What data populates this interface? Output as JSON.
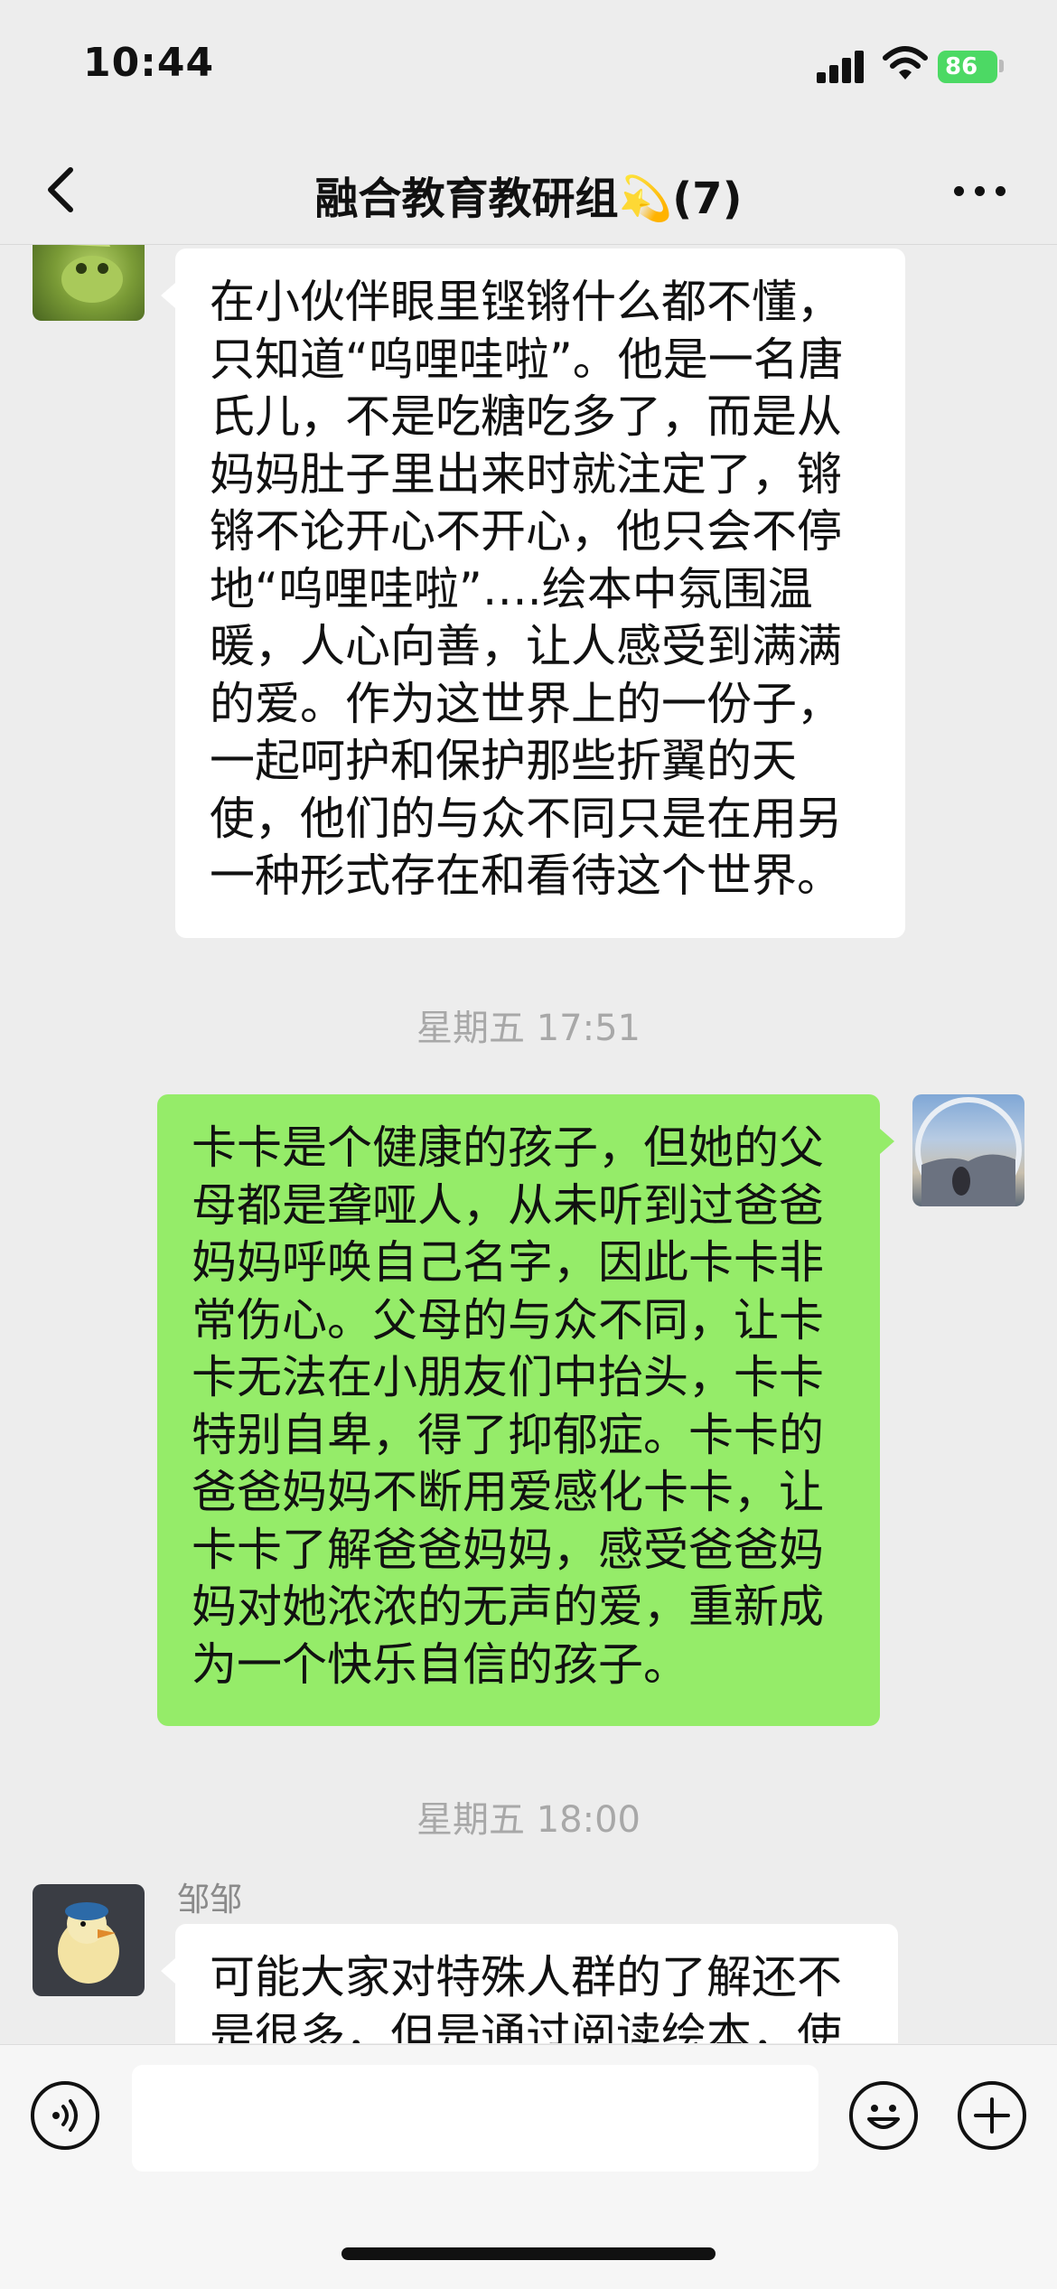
{
  "status_bar": {
    "time": "10:44",
    "battery": "86"
  },
  "nav": {
    "title": "融合教育教研组💫(7)"
  },
  "messages": [
    {
      "type": "left",
      "text": "在小伙伴眼里铿锵什么都不懂，只知道“呜哩哇啦”。他是一名唐氏儿，不是吃糖吃多了，而是从妈妈肚子里出来时就注定了，锵锵不论开心不开心，他只会不停地“呜哩哇啦”….绘本中氛围温暖，人心向善，让人感受到满满的爱。作为这世界上的一份子，一起呵护和保护那些折翼的天使，他们的与众不同只是在用另一种形式存在和看待这个世界。"
    },
    {
      "type": "time",
      "text": "星期五 17:51"
    },
    {
      "type": "right",
      "text": "卡卡是个健康的孩子，但她的父母都是聋哑人，从未听到过爸爸妈妈呼唤自己名字，因此卡卡非常伤心。父母的与众不同，让卡卡无法在小朋友们中抬头，卡卡特别自卑，得了抑郁症。卡卡的爸爸妈妈不断用爱感化卡卡，让卡卡了解爸爸妈妈，感受爸爸妈妈对她浓浓的无声的爱，重新成为一个快乐自信的孩子。"
    },
    {
      "type": "time",
      "text": "星期五 18:00"
    },
    {
      "type": "left",
      "sender": "邹邹",
      "text": "可能大家对特殊人群的了解还不是很多，但是通过阅读绘本，使"
    }
  ],
  "icons": {
    "back": "chevron-left-icon",
    "more": "more-dots-icon",
    "voice": "voice-icon",
    "emoji": "emoji-icon",
    "add": "plus-icon"
  },
  "colors": {
    "outgoing_bubble": "#95ec69",
    "incoming_bubble": "#ffffff",
    "background": "#ededed",
    "battery": "#4cd964"
  }
}
